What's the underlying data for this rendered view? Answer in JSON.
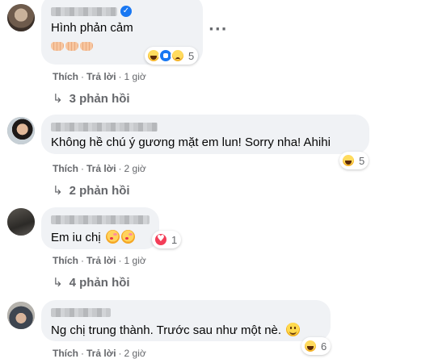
{
  "comments": [
    {
      "text": "Hình phản cảm",
      "reaction_count": "5",
      "like_label": "Thích",
      "reply_label": "Trả lời",
      "time": "1 giờ",
      "replies_label": "3 phản hồi"
    },
    {
      "text": "Không hề chú ý gương mặt em lun! Sorry nha! Ahihi",
      "reaction_count": "5",
      "like_label": "Thích",
      "reply_label": "Trả lời",
      "time": "2 giờ",
      "replies_label": "2 phản hồi"
    },
    {
      "text": "Em iu chị",
      "reaction_count": "1",
      "like_label": "Thích",
      "reply_label": "Trả lời",
      "time": "1 giờ",
      "replies_label": "4 phản hồi"
    },
    {
      "text": "Ng chị trung thành. Trước sau như một nè.",
      "reaction_count": "6",
      "like_label": "Thích",
      "reply_label": "Trả lời",
      "time": "2 giờ"
    }
  ],
  "icons": {
    "reply_arrow": "reply-arrow-icon",
    "verified": "verified-badge-icon",
    "more": "more-options-icon",
    "haha": "haha-reaction-icon",
    "like": "like-reaction-icon",
    "sad": "sad-reaction-icon",
    "love": "love-reaction-icon"
  },
  "colors": {
    "bubble": "#f0f2f5",
    "secondary_text": "#65676b",
    "accent": "#1877f2",
    "love": "#f33e58"
  }
}
